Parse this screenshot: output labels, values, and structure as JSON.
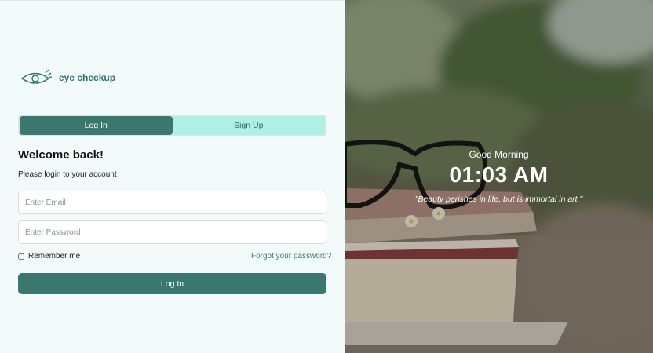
{
  "brand": {
    "name": "eye checkup",
    "icon": "eye-icon",
    "color": "#2e6f68"
  },
  "tabs": [
    {
      "label": "Log In",
      "active": true
    },
    {
      "label": "Sign Up",
      "active": false
    }
  ],
  "form": {
    "heading": "Welcome back!",
    "subtitle": "Please login to your account",
    "email_placeholder": "Enter Email",
    "email_value": "",
    "password_placeholder": "Enter Password",
    "password_value": "",
    "remember_label": "Remember me",
    "remember_checked": false,
    "forgot_label": "Forgot your password?",
    "submit_label": "Log In"
  },
  "hero": {
    "greeting": "Good Morning",
    "time": "01:03 AM",
    "quote": "\"Beauty perishes in life, but is immortal in art.\""
  },
  "colors": {
    "accent": "#3a776f",
    "tab_background": "#aef0e3",
    "panel_background": "#f2fbf9"
  }
}
